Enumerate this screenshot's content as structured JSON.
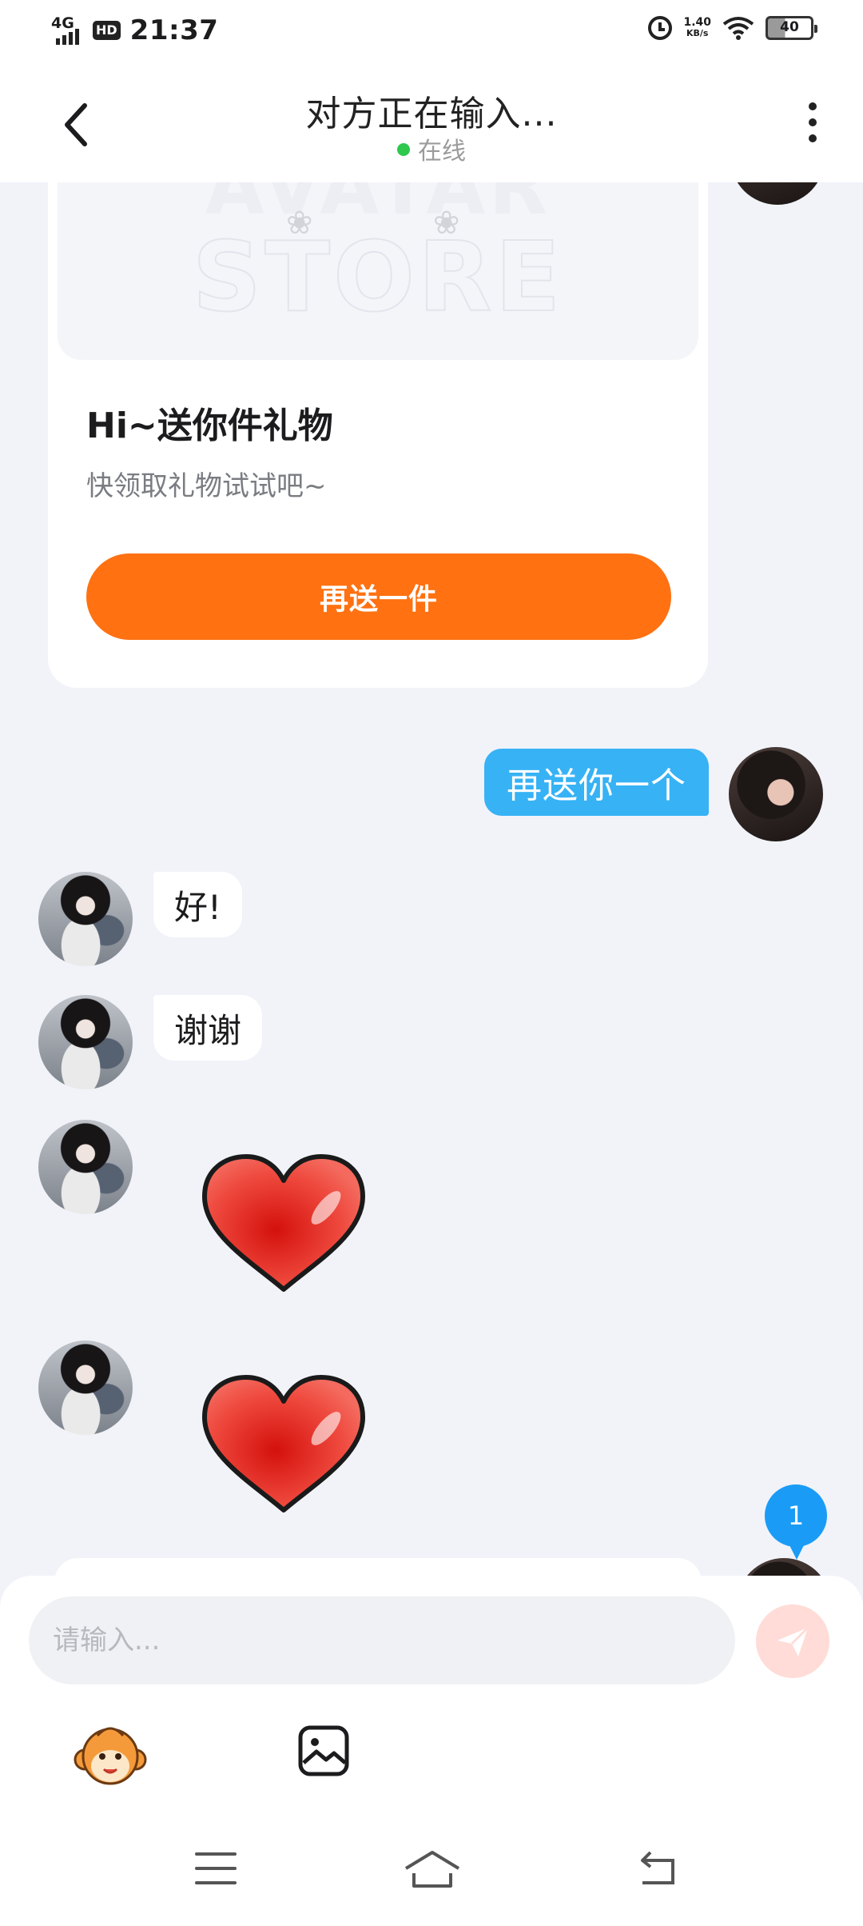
{
  "status_bar": {
    "network": "4G",
    "hd": "HD",
    "time": "21:37",
    "speed_value": "1.40",
    "speed_unit": "KB/s",
    "battery": "40"
  },
  "header": {
    "title": "对方正在输入...",
    "status": "在线"
  },
  "chat": {
    "gift_card": {
      "title": "Hi~送你件礼物",
      "subtitle": "快领取礼物试试吧~",
      "button_label": "再送一件"
    },
    "messages": [
      {
        "sender": "me",
        "text": "再送你一个"
      },
      {
        "sender": "other",
        "text": "好!"
      },
      {
        "sender": "other",
        "text": "谢谢"
      }
    ],
    "unread_count": "1"
  },
  "input": {
    "placeholder": "请输入..."
  },
  "colors": {
    "accent_orange": "#ff7111",
    "my_bubble": "#37b2f5",
    "online": "#2dc84d",
    "badge": "#1a9cf6"
  }
}
